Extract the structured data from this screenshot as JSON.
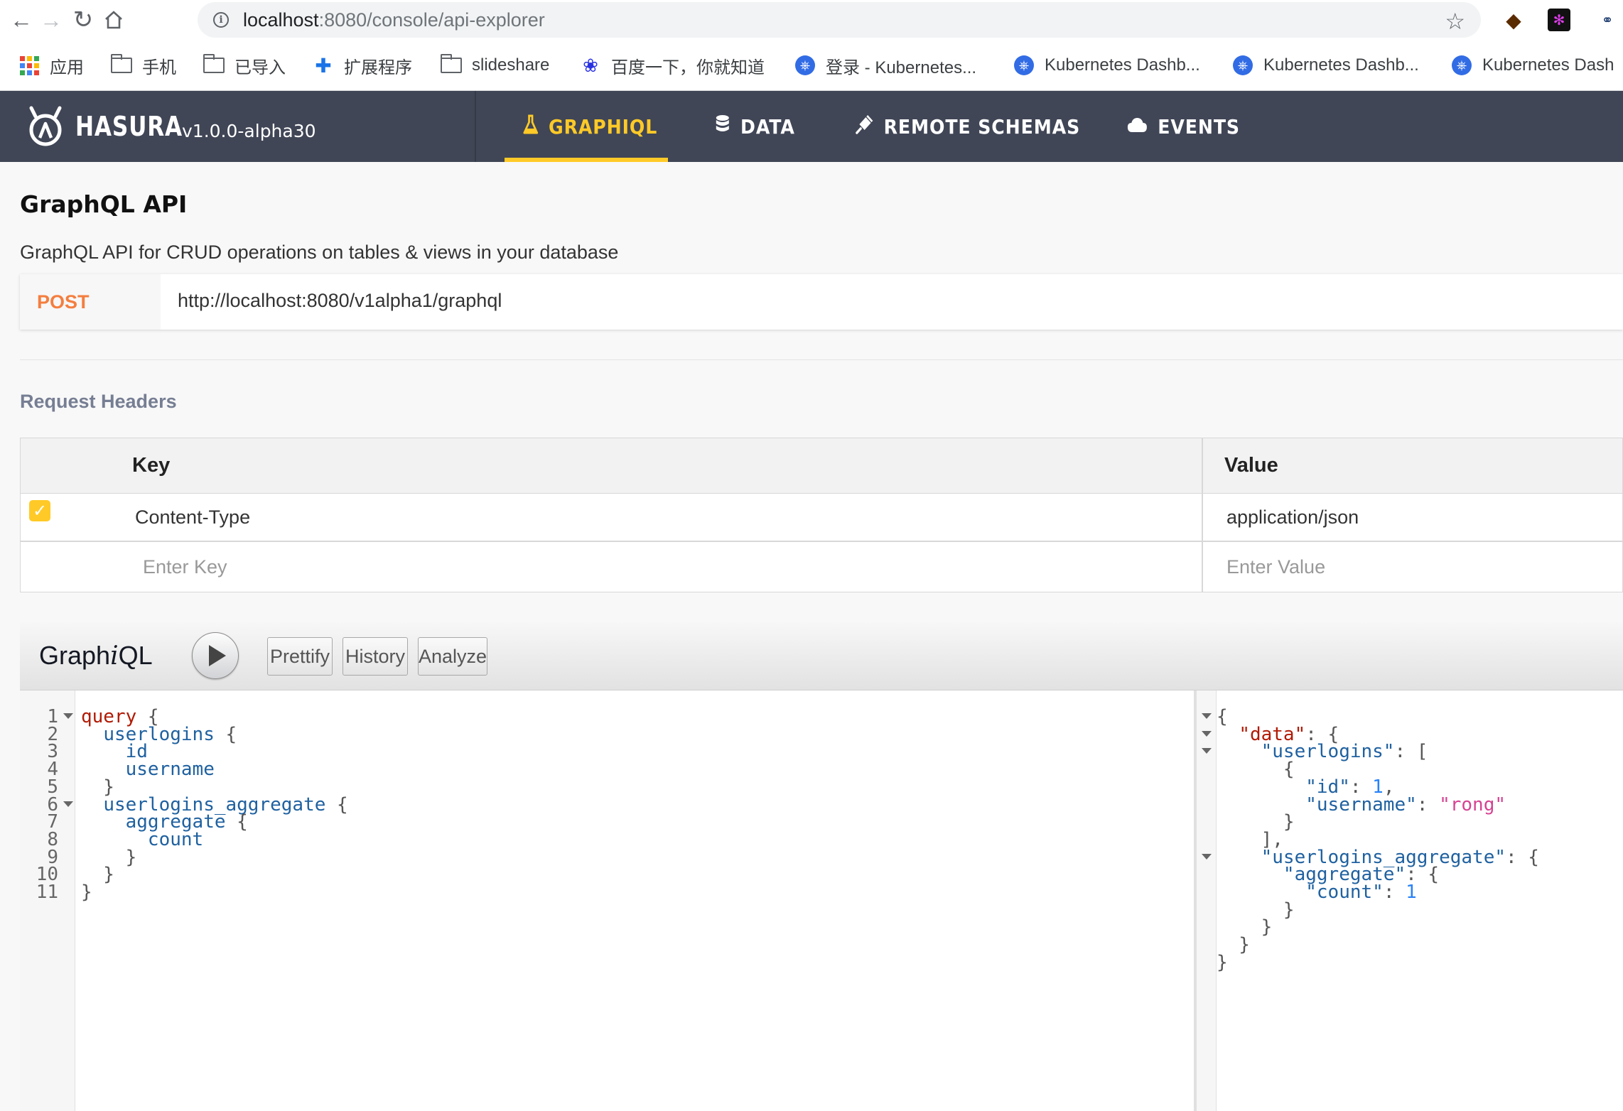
{
  "browser": {
    "url_host": "localhost",
    "url_rest": ":8080/console/api-explorer",
    "bookmarks": [
      {
        "label": "应用",
        "icon": "apps-grid-icon"
      },
      {
        "label": "手机",
        "icon": "folder-icon"
      },
      {
        "label": "已导入",
        "icon": "folder-icon"
      },
      {
        "label": "扩展程序",
        "icon": "puzzle-icon"
      },
      {
        "label": "slideshare",
        "icon": "folder-icon"
      },
      {
        "label": "百度一下，你就知道",
        "icon": "baidu-paw-icon"
      },
      {
        "label": "登录 - Kubernetes...",
        "icon": "kubernetes-icon"
      },
      {
        "label": "Kubernetes Dashb...",
        "icon": "kubernetes-icon"
      },
      {
        "label": "Kubernetes Dashb...",
        "icon": "kubernetes-icon"
      },
      {
        "label": "Kubernetes Dash",
        "icon": "kubernetes-icon"
      }
    ]
  },
  "header": {
    "logo_text": "HASURA",
    "version": "v1.0.0-alpha30",
    "tabs": [
      {
        "label": "GRAPHIQL",
        "icon": "flask-icon",
        "active": true
      },
      {
        "label": "DATA",
        "icon": "database-icon",
        "active": false
      },
      {
        "label": "REMOTE SCHEMAS",
        "icon": "plug-icon",
        "active": false
      },
      {
        "label": "EVENTS",
        "icon": "cloud-icon",
        "active": false
      }
    ],
    "accent_color": "#ffca27",
    "bg_color": "#404656"
  },
  "page": {
    "title": "GraphQL API",
    "description": "GraphQL API for CRUD operations on tables & views in your database"
  },
  "endpoint": {
    "method": "POST",
    "url": "http://localhost:8080/v1alpha1/graphql"
  },
  "request_headers": {
    "title": "Request Headers",
    "col_key": "Key",
    "col_value": "Value",
    "rows": [
      {
        "checked": true,
        "key": "Content-Type",
        "value": "application/json"
      }
    ],
    "key_placeholder": "Enter Key",
    "value_placeholder": "Enter Value"
  },
  "graphiql": {
    "title_prefix": "Graph",
    "title_italic": "i",
    "title_suffix": "QL",
    "buttons": {
      "prettify": "Prettify",
      "history": "History",
      "analyze": "Analyze"
    },
    "query_lines": [
      "query {",
      "  userlogins {",
      "    id",
      "    username",
      "  }",
      "  userlogins_aggregate {",
      "    aggregate {",
      "      count",
      "    }",
      "  }",
      "}"
    ],
    "result_lines": [
      "{",
      "  \"data\": {",
      "    \"userlogins\": [",
      "      {",
      "        \"id\": 1,",
      "        \"username\": \"rong\"",
      "      }",
      "    ],",
      "    \"userlogins_aggregate\": {",
      "      \"aggregate\": {",
      "        \"count\": 1",
      "      }",
      "    }",
      "  }",
      "}"
    ]
  }
}
